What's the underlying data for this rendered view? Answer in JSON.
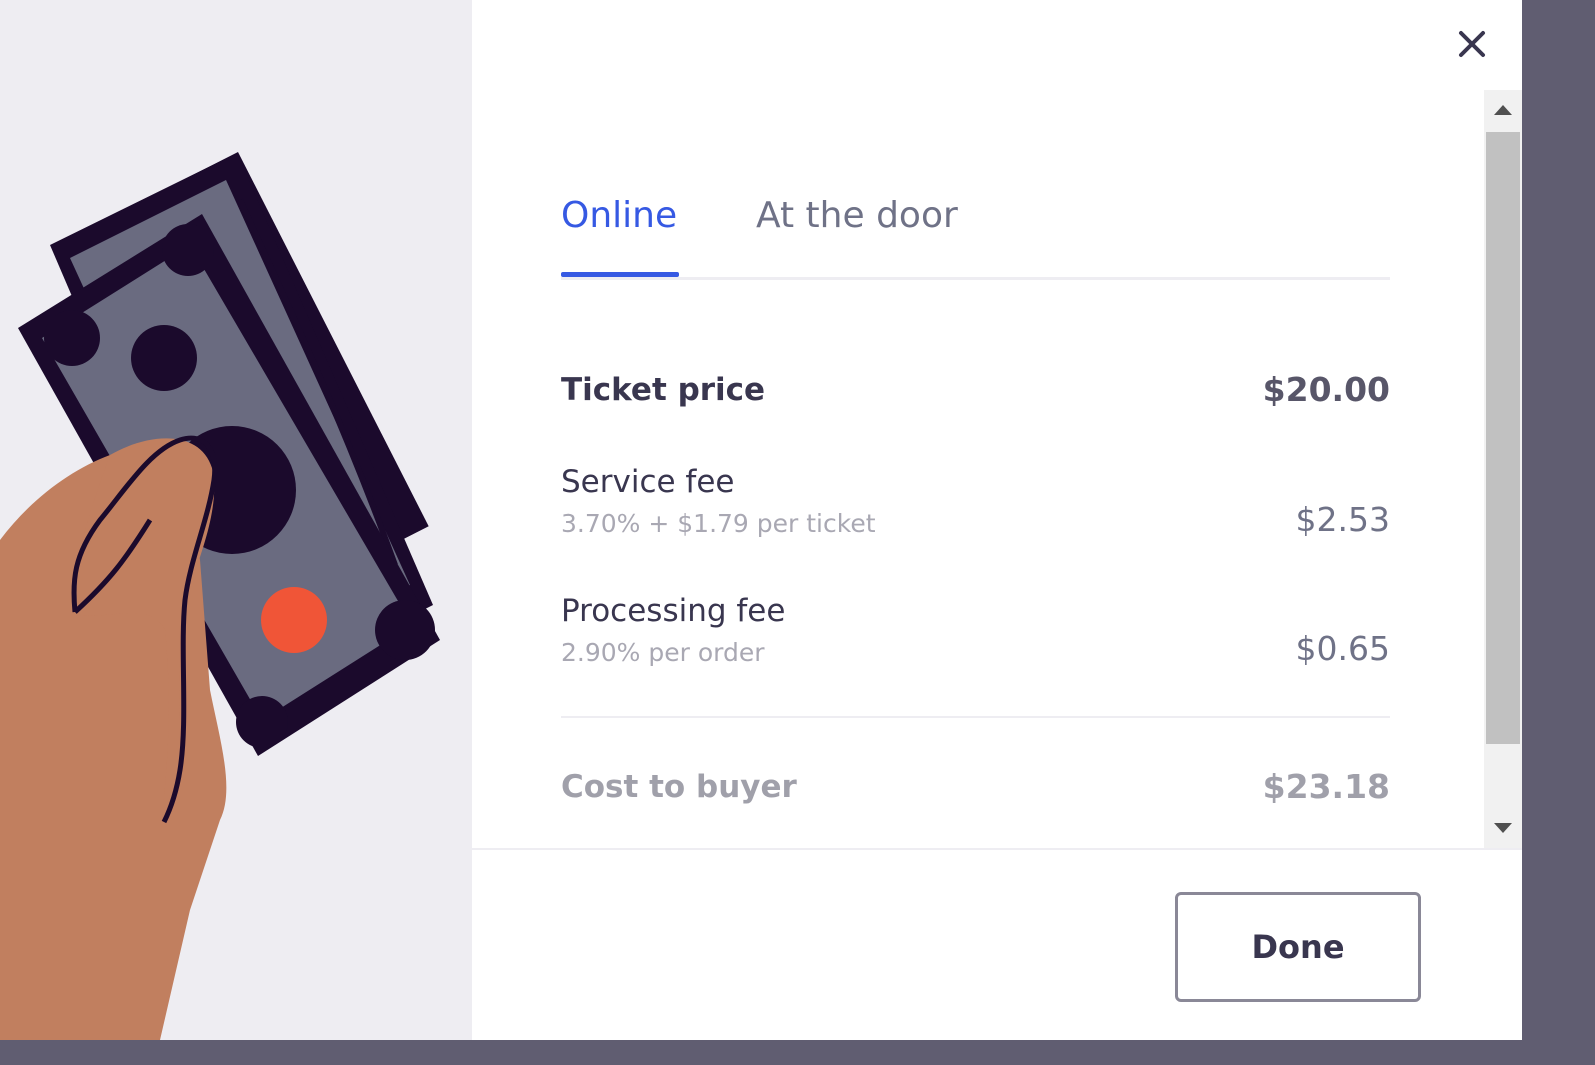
{
  "close": {
    "icon": "close-icon"
  },
  "tabs": [
    {
      "label": "Online",
      "active": true
    },
    {
      "label": "At the door",
      "active": false
    }
  ],
  "fees": {
    "ticket_price": {
      "label": "Ticket price",
      "amount": "$20.00"
    },
    "service_fee": {
      "label": "Service fee",
      "detail": "3.70% + $1.79 per ticket",
      "amount": "$2.53"
    },
    "processing_fee": {
      "label": "Processing fee",
      "detail": "2.90% per order",
      "amount": "$0.65"
    },
    "total": {
      "label": "Cost to buyer",
      "amount": "$23.18"
    }
  },
  "footer": {
    "done_label": "Done"
  },
  "colors": {
    "accent": "#3659e3",
    "text_dark": "#39364f",
    "text_muted": "#6f7287",
    "illustration_bg": "#eeedf2",
    "overlay": "#605d71"
  }
}
